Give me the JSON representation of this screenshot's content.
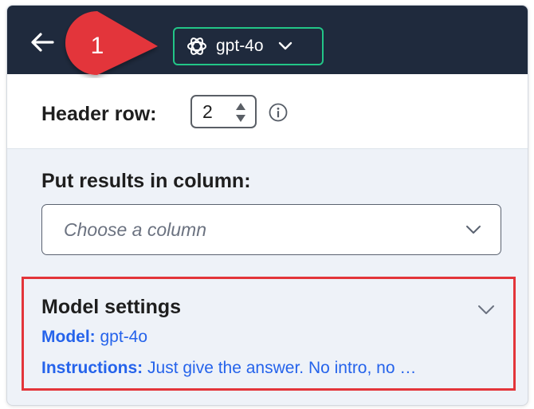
{
  "topbar": {
    "model_label": "gpt-4o",
    "icons": {
      "back": "arrow-left-icon",
      "model_logo": "openai-logo-icon",
      "dropdown": "chevron-down-icon"
    }
  },
  "callout": {
    "number": "1",
    "color": "#e3353a"
  },
  "header_row": {
    "label": "Header row:",
    "value": "2",
    "info_icon": "info-icon"
  },
  "results": {
    "label": "Put results in column:",
    "placeholder": "Choose a column"
  },
  "model_settings": {
    "title": "Model settings",
    "model_key": "Model:",
    "model_value": "gpt-4o",
    "instructions_key": "Instructions:",
    "instructions_value": "Just give the answer. No intro, no …"
  },
  "colors": {
    "topbar": "#1f2a3d",
    "model_border": "#22c587",
    "link": "#2563eb",
    "highlight": "#e3353a"
  }
}
